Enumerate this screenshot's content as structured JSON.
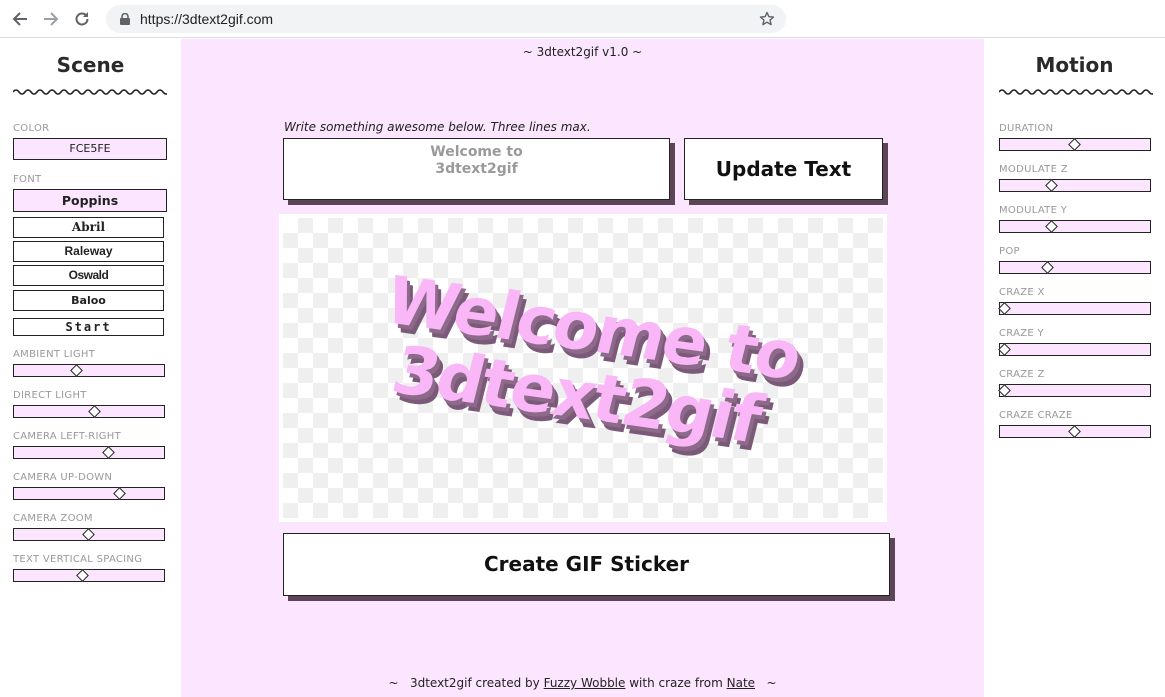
{
  "browser": {
    "url": "https://3dtext2gif.com",
    "icons": [
      "back-arrow-icon",
      "forward-arrow-icon",
      "reload-icon",
      "lock-icon",
      "star-icon"
    ]
  },
  "scene": {
    "title": "Scene",
    "color_label": "COLOR",
    "color_value": "FCE5FE",
    "font_label": "FONT",
    "fonts": [
      "Poppins",
      "Abril",
      "Raleway",
      "Oswald",
      "Baloo",
      "Start"
    ],
    "active_font": "Poppins",
    "sliders": [
      {
        "label": "AMBIENT LIGHT",
        "value": 0.42
      },
      {
        "label": "DIRECT LIGHT",
        "value": 0.55
      },
      {
        "label": "CAMERA LEFT-RIGHT",
        "value": 0.65
      },
      {
        "label": "CAMERA UP-DOWN",
        "value": 0.73
      },
      {
        "label": "CAMERA ZOOM",
        "value": 0.5
      },
      {
        "label": "TEXT VERTICAL SPACING",
        "value": 0.46
      }
    ]
  },
  "center": {
    "version": "~   3dtext2gif v1.0   ~",
    "hint": "Write something awesome below. Three lines max.",
    "text_value": "Welcome to\n3dtext2gif",
    "update_label": "Update Text",
    "preview_line1": "Welcome to",
    "preview_line2": "3dtext2gif",
    "create_label": "Create GIF Sticker",
    "footer_prefix": "~   3dtext2gif created by ",
    "footer_link1": "Fuzzy Wobble",
    "footer_mid": " with craze from ",
    "footer_link2": "Nate",
    "footer_suffix": "   ~"
  },
  "motion": {
    "title": "Motion",
    "sliders": [
      {
        "label": "DURATION",
        "value": 0.5
      },
      {
        "label": "MODULATE Z",
        "value": 0.34
      },
      {
        "label": "MODULATE Y",
        "value": 0.34
      },
      {
        "label": "POP",
        "value": 0.31
      },
      {
        "label": "CRAZE X",
        "value": 0.0
      },
      {
        "label": "CRAZE Y",
        "value": 0.0
      },
      {
        "label": "CRAZE Z",
        "value": 0.0
      },
      {
        "label": "CRAZE CRAZE",
        "value": 0.5
      }
    ]
  },
  "colors": {
    "accent_pink": "#fce5fe",
    "shadow": "#5b4556",
    "text_pink": "#f9b7f7",
    "text_side": "#7a5a78"
  }
}
